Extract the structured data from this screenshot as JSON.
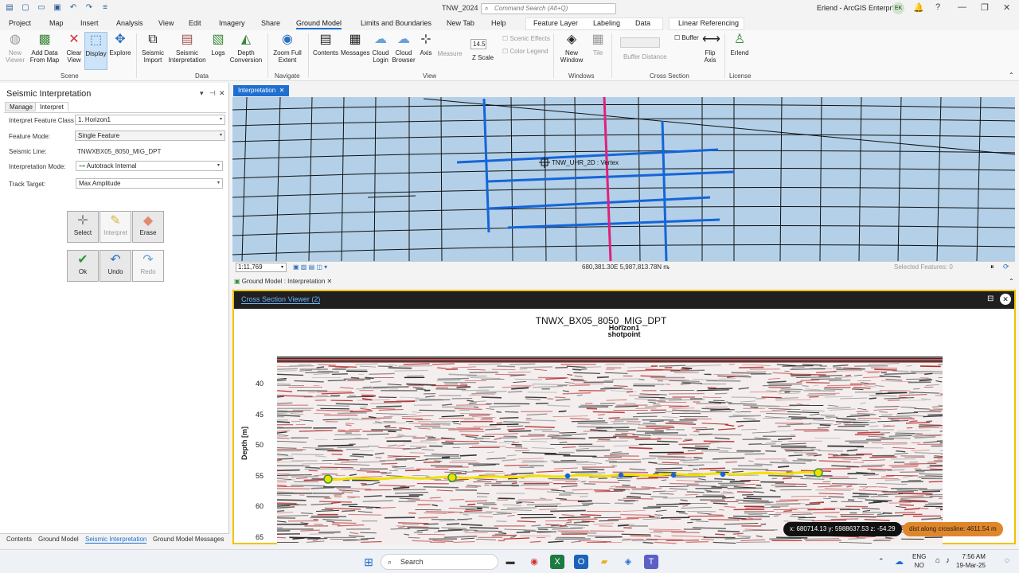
{
  "titlebar": {
    "document_title": "TNW_2024",
    "command_search_placeholder": "Command Search (Alt+Q)",
    "user": "Erlend - ArcGIS Enterprise",
    "avatar_initials": "EK"
  },
  "tabs": [
    "Project",
    "Map",
    "Insert",
    "Analysis",
    "View",
    "Edit",
    "Imagery",
    "Share",
    "Ground Model",
    "Limits and Boundaries",
    "New Tab",
    "Help"
  ],
  "active_tab": "Ground Model",
  "context_tabs": [
    "Feature Layer",
    "Labeling",
    "Data",
    "Linear Referencing"
  ],
  "ribbon": {
    "scene": {
      "group": "Scene",
      "buttons": [
        "New Viewer",
        "Add Data From Map",
        "Clear View",
        "Display",
        "Explore"
      ]
    },
    "data": {
      "group": "Data",
      "buttons": [
        "Seismic Import",
        "Seismic Interpretation",
        "Logs",
        "Depth Conversion"
      ]
    },
    "navigate": {
      "group": "Navigate",
      "buttons": [
        "Zoom Full Extent"
      ]
    },
    "view": {
      "group": "View",
      "buttons": [
        "Contents",
        "Messages",
        "Cloud Login",
        "Cloud Browser",
        "Axis",
        "Measure"
      ],
      "z_scale_value": "14.5",
      "z_scale_label": "Z Scale",
      "scenic_effects": "Scenic Effects",
      "color_legend": "Color Legend"
    },
    "windows": {
      "group": "Windows",
      "buttons": [
        "New Window",
        "Tile"
      ]
    },
    "cross_section": {
      "group": "Cross Section",
      "buffer": "Buffer",
      "buffer_distance": "Buffer Distance",
      "flip_axis": "Flip Axis"
    },
    "license": {
      "group": "License",
      "user": "Erlend"
    }
  },
  "pane": {
    "title": "Seismic Interpretation",
    "tabs": [
      "Manage",
      "Interpret"
    ],
    "active_tab": "Interpret",
    "fields": {
      "interpret_feature_class_label": "Interpret Feature Class",
      "interpret_feature_class_value": "1. Horizon1",
      "feature_mode_label": "Feature Mode:",
      "feature_mode_value": "Single Feature",
      "seismic_line_label": "Seismic Line:",
      "seismic_line_value": "TNWXBX05_8050_MIG_DPT",
      "interpretation_mode_label": "Interpretation Mode:",
      "interpretation_mode_value": "Autotrack Internal",
      "track_target_label": "Track Target:",
      "track_target_value": "Max Amplitude"
    },
    "tools": [
      "Select",
      "Interpret",
      "Erase",
      "Ok",
      "Undo",
      "Redo"
    ]
  },
  "bottom_tabs": [
    "Contents",
    "Ground Model",
    "Seismic Interpretation",
    "Ground Model Messages"
  ],
  "active_bottom_tab": "Seismic Interpretation",
  "map": {
    "tab": "Interpretation",
    "cursor_label": "TNW_UHR_2D : Vertex",
    "scale": "1:11,769",
    "coords": "680,381.30E 5,987,813.78N m",
    "selected_features": "Selected Features: 0",
    "colors": {
      "water": "#b3d0e8",
      "lines": "#111111",
      "selected_lines": "#1565d8",
      "active_line": "#e0207a"
    }
  },
  "ground_model_tab": "Ground Model : Interpretation",
  "cross_section": {
    "tab": "Cross Section Viewer (2)",
    "title": "TNWX_BX05_8050_MIG_DPT",
    "subtitle1": "Horizon1",
    "subtitle2": "shotpoint",
    "ylabel": "Depth [m]",
    "yticks": [
      "40",
      "45",
      "50",
      "55",
      "60",
      "65"
    ],
    "readout": "x: 680714.13 y: 5988637.53 z: -54.29",
    "distance": "dist along crossline: 4611.54 m",
    "horizon_color": "#f0e000"
  },
  "taskbar": {
    "search": "Search",
    "lang1": "ENG",
    "lang2": "NO",
    "time": "7:56 AM",
    "date": "19-Mar-25"
  }
}
